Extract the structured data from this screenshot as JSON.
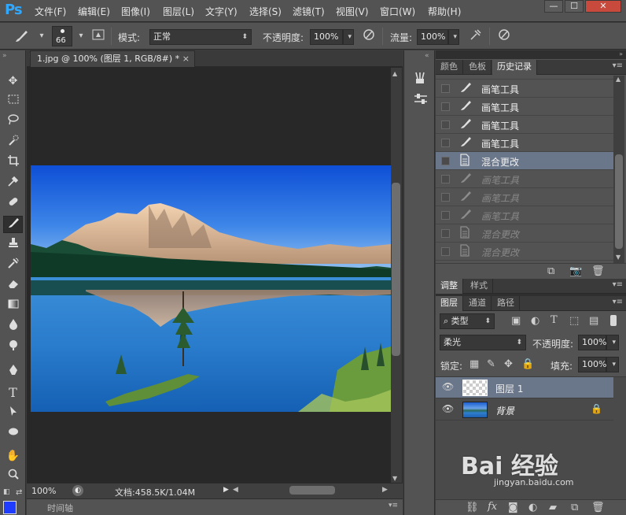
{
  "menubar": {
    "logo": "Ps",
    "items": [
      "文件(F)",
      "编辑(E)",
      "图像(I)",
      "图层(L)",
      "文字(Y)",
      "选择(S)",
      "滤镜(T)",
      "视图(V)",
      "窗口(W)",
      "帮助(H)"
    ],
    "window_controls": [
      "—",
      "☐",
      "✕"
    ]
  },
  "options": {
    "brush_size": "66",
    "mode_label": "模式:",
    "mode_value": "正常",
    "opacity_label": "不透明度:",
    "opacity_value": "100%",
    "flow_label": "流量:",
    "flow_value": "100%"
  },
  "document": {
    "tab_title": "1.jpg @ 100% (图层 1, RGB/8#) *",
    "tab_close": "×",
    "zoom": "100%",
    "doc_info": "文档:458.5K/1.04M",
    "timeline_label": "时间轴"
  },
  "history_panel": {
    "tabs": [
      "颜色",
      "色板",
      "历史记录"
    ],
    "active_tab": "历史记录",
    "rows": [
      {
        "label": "画笔工具",
        "icon": "brush-icon",
        "state": "normal"
      },
      {
        "label": "画笔工具",
        "icon": "brush-icon",
        "state": "normal"
      },
      {
        "label": "画笔工具",
        "icon": "brush-icon",
        "state": "normal"
      },
      {
        "label": "画笔工具",
        "icon": "brush-icon",
        "state": "normal"
      },
      {
        "label": "混合更改",
        "icon": "document-icon",
        "state": "selected"
      },
      {
        "label": "画笔工具",
        "icon": "brush-icon",
        "state": "dim"
      },
      {
        "label": "画笔工具",
        "icon": "brush-icon",
        "state": "dim"
      },
      {
        "label": "画笔工具",
        "icon": "brush-icon",
        "state": "dim"
      },
      {
        "label": "混合更改",
        "icon": "document-icon",
        "state": "dim"
      },
      {
        "label": "混合更改",
        "icon": "document-icon",
        "state": "dim"
      }
    ]
  },
  "adjust_panel": {
    "tabs": [
      "调整",
      "样式"
    ]
  },
  "layers_panel": {
    "tabs": [
      "图层",
      "通道",
      "路径"
    ],
    "filter_kind": "类型",
    "blend_mode": "柔光",
    "opacity_label": "不透明度:",
    "opacity_value": "100%",
    "lock_label": "锁定:",
    "fill_label": "填充:",
    "fill_value": "100%",
    "layers": [
      {
        "name": "图层 1",
        "selected": true,
        "locked": false
      },
      {
        "name": "背景",
        "selected": false,
        "locked": true
      }
    ]
  },
  "watermark": {
    "main": "Bai 经验",
    "sub": "jingyan.baidu.com"
  },
  "colors": {
    "accent_selection": "#6a7689",
    "ps_blue": "#31a8ff",
    "foreground_swatch": "#1f3cff"
  }
}
